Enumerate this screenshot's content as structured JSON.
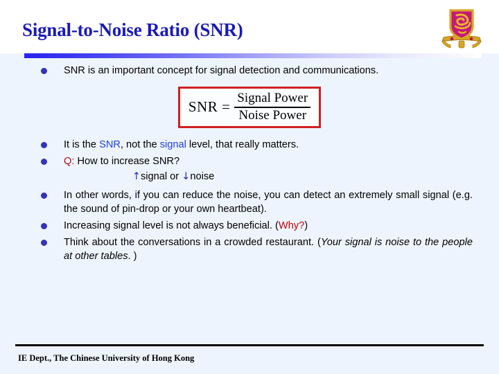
{
  "slide": {
    "title": "Signal-to-Noise Ratio (SNR)",
    "background_color": "#eef4fd",
    "title_color": "#1a1ab8",
    "accent_color": "#2a24ef",
    "bullet_color": "#3333b5",
    "highlight_blue": "#1f3fd8",
    "highlight_red": "#c00000",
    "formula_border_color": "#d02020"
  },
  "logo": {
    "name": "cuhk-crest",
    "shield_color": "#c4197c",
    "emblem_color": "#e8a91e",
    "base_color": "#d9a520"
  },
  "bullets": {
    "b1": {
      "text": "SNR is an important concept for signal detection and communications."
    },
    "b2": {
      "part1": "It is the ",
      "kw1": "SNR",
      "part2": ", not the ",
      "kw2": "signal",
      "part3": " level, that really matters."
    },
    "b3": {
      "q": "Q:",
      "text": " How to increase SNR?"
    },
    "b3_sub": {
      "up_arrow": "↑",
      "word1": "signal",
      "conj": " or ",
      "down_arrow": "↓",
      "word2": "noise"
    },
    "b4": {
      "text": "In other words, if you can reduce the noise, you can detect an extremely small signal (e.g. the sound of pin-drop or your own heartbeat)."
    },
    "b5": {
      "part1": "Increasing signal level is not always beneficial. (",
      "kw": "Why?",
      "part2": ")"
    },
    "b6": {
      "part1": "Think about the conversations in a crowded restaurant. (",
      "italic": "Your signal is noise to the people at other tables",
      "part2": ". )"
    }
  },
  "formula": {
    "lhs": "SNR =",
    "numerator": "Signal Power",
    "denominator": "Noise Power"
  },
  "footer": {
    "text": "IE Dept., The Chinese University of Hong Kong"
  }
}
